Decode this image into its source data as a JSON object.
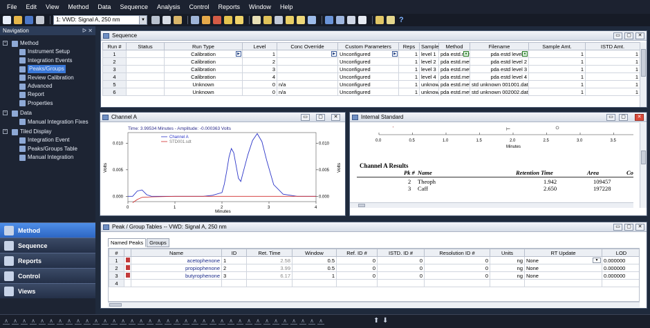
{
  "menu": [
    "File",
    "Edit",
    "View",
    "Method",
    "Data",
    "Sequence",
    "Analysis",
    "Control",
    "Reports",
    "Window",
    "Help"
  ],
  "toolbar": {
    "signal_select": "1: VWD: Signal A, 250 nm"
  },
  "navigation": {
    "title": "Navigation",
    "pin": "p ×",
    "items": [
      {
        "label": "Method",
        "level": 0
      },
      {
        "label": "Instrument Setup",
        "level": 1
      },
      {
        "label": "Integration Events",
        "level": 1
      },
      {
        "label": "Peaks/Groups",
        "level": 1,
        "selected": true
      },
      {
        "label": "Review Calibration",
        "level": 1
      },
      {
        "label": "Advanced",
        "level": 1
      },
      {
        "label": "Report",
        "level": 1
      },
      {
        "label": "Properties",
        "level": 1
      },
      {
        "label": "Data",
        "level": 0
      },
      {
        "label": "Manual Integration Fixes",
        "level": 1
      },
      {
        "label": "Tiled Display",
        "level": 0
      },
      {
        "label": "Integration Event",
        "level": 1
      },
      {
        "label": "Peaks/Groups Table",
        "level": 1
      },
      {
        "label": "Manual Integration",
        "level": 1
      }
    ],
    "buttons": [
      "Method",
      "Sequence",
      "Reports",
      "Control",
      "Views"
    ]
  },
  "sequence": {
    "title": "Sequence",
    "columns": [
      "Run #",
      "Status",
      "Run Type",
      "Level",
      "Conc Override",
      "Custom Parameters",
      "Reps",
      "Sample",
      "Method",
      "Filename",
      "Sample Amt.",
      "ISTD Amt."
    ],
    "rows": [
      [
        "1",
        "",
        "Calibration",
        "1",
        "",
        "Unconfigured",
        "1",
        "level 1",
        "pda estd.met",
        "pda estd level 1",
        "1",
        "1"
      ],
      [
        "2",
        "",
        "Calibration",
        "2",
        "",
        "Unconfigured",
        "1",
        "level 2",
        "pda estd.met",
        "pda estd level 2",
        "1",
        "1"
      ],
      [
        "3",
        "",
        "Calibration",
        "3",
        "",
        "Unconfigured",
        "1",
        "level 3",
        "pda estd.met",
        "pda estd level 3",
        "1",
        "1"
      ],
      [
        "4",
        "",
        "Calibration",
        "4",
        "",
        "Unconfigured",
        "1",
        "level 4",
        "pda estd.met",
        "pda estd level 4",
        "1",
        "1"
      ],
      [
        "5",
        "",
        "Unknown",
        "0",
        "n/a",
        "Unconfigured",
        "1",
        "unknow",
        "pda estd.met",
        "std unknown 001001.dat",
        "1",
        "1"
      ],
      [
        "6",
        "",
        "Unknown",
        "0",
        "n/a",
        "Unconfigured",
        "1",
        "unknow",
        "pda estd.met",
        "std unknown 002002.dat",
        "1",
        "1"
      ]
    ]
  },
  "channel_a": {
    "title": "Channel A",
    "readout": "Time:  3.99534 Minutes - Amplitude:  -0.000363 Volts",
    "legend": [
      "Channel A",
      "STD001.sdt"
    ],
    "ylabel_left": "Volts",
    "ylabel_right": "Volts",
    "xlabel": "Minutes"
  },
  "chart_data": {
    "type": "line",
    "xlabel": "Minutes",
    "ylabel": "Volts",
    "xlim": [
      0,
      4
    ],
    "ylim": [
      -0.001,
      0.012
    ],
    "xticks": [
      "0",
      "1",
      "2",
      "3",
      "4"
    ],
    "yticks": [
      "0.000",
      "0.005",
      "0.010"
    ],
    "series": [
      {
        "name": "Channel A",
        "color": "#2b35c8",
        "x": [
          0,
          0.1,
          0.2,
          0.3,
          0.4,
          0.5,
          0.7,
          1.0,
          1.3,
          1.6,
          1.8,
          2.0,
          2.05,
          2.1,
          2.15,
          2.2,
          2.25,
          2.3,
          2.35,
          2.4,
          2.45,
          2.55,
          2.65,
          2.75,
          2.85,
          2.95,
          3.1,
          3.3,
          3.6,
          4.0
        ],
        "y": [
          0,
          0,
          0.001,
          0.0012,
          0.0003,
          0.0,
          0.0,
          0.0,
          0.0,
          0.0,
          0.0002,
          0.0007,
          0.0023,
          0.0047,
          0.0074,
          0.009,
          0.0082,
          0.0058,
          0.0034,
          0.0028,
          0.0045,
          0.0078,
          0.0105,
          0.0118,
          0.0103,
          0.0068,
          0.0022,
          0.0004,
          0.0,
          0.0
        ]
      },
      {
        "name": "STD001.sdt",
        "color": "#d02a2a",
        "x": [
          0.1,
          0.2,
          0.3,
          0.5,
          1.0,
          2.0,
          3.0,
          4.0
        ],
        "y": [
          -0.0012,
          -0.0006,
          -0.0002,
          -0.0001,
          0.0,
          0.0,
          0.0,
          0.0
        ]
      }
    ]
  },
  "internal_standard": {
    "title": "Internal Standard",
    "axis_ticks": [
      "0.0",
      "0.5",
      "1.0",
      "1.5",
      "2.0",
      "2.5",
      "3.0",
      "3.5"
    ],
    "axis_label": "Minutes",
    "results_title": "Channel A Results",
    "headers": [
      "Pk #",
      "Name",
      "Retention Time",
      "Area",
      "Co"
    ],
    "rows": [
      [
        "2",
        "Theoph",
        "1.942",
        "109457"
      ],
      [
        "3",
        "Caff",
        "2.650",
        "197228"
      ]
    ]
  },
  "peak_tables": {
    "title": "Peak / Group Tables -- VWD: Signal A, 250 nm",
    "tabs": [
      "Named Peaks",
      "Groups"
    ],
    "columns": [
      "#",
      "",
      "Name",
      "ID",
      "Ret. Time",
      "Window",
      "Ref. ID #",
      "ISTD. ID #",
      "Resolution ID #",
      "Units",
      "RT Update",
      "LOD"
    ],
    "rows": [
      [
        "1",
        "acetophenone",
        "1",
        "2.58",
        "0.5",
        "0",
        "0",
        "0",
        "ng",
        "None",
        "0.000000"
      ],
      [
        "2",
        "propiophenone",
        "2",
        "3.99",
        "0.5",
        "0",
        "0",
        "0",
        "ng",
        "None",
        "0.000000"
      ],
      [
        "3",
        "butyrophenone",
        "3",
        "6.17",
        "1",
        "0",
        "0",
        "0",
        "ng",
        "None",
        "0.000000"
      ],
      [
        "4",
        "",
        "",
        "",
        "",
        "",
        "",
        "",
        "",
        "",
        ""
      ]
    ]
  },
  "colors": {
    "accent": "#3a78d8",
    "navy": "#1d2433",
    "peak_series": "#2b35c8",
    "std_series": "#d02a2a"
  }
}
